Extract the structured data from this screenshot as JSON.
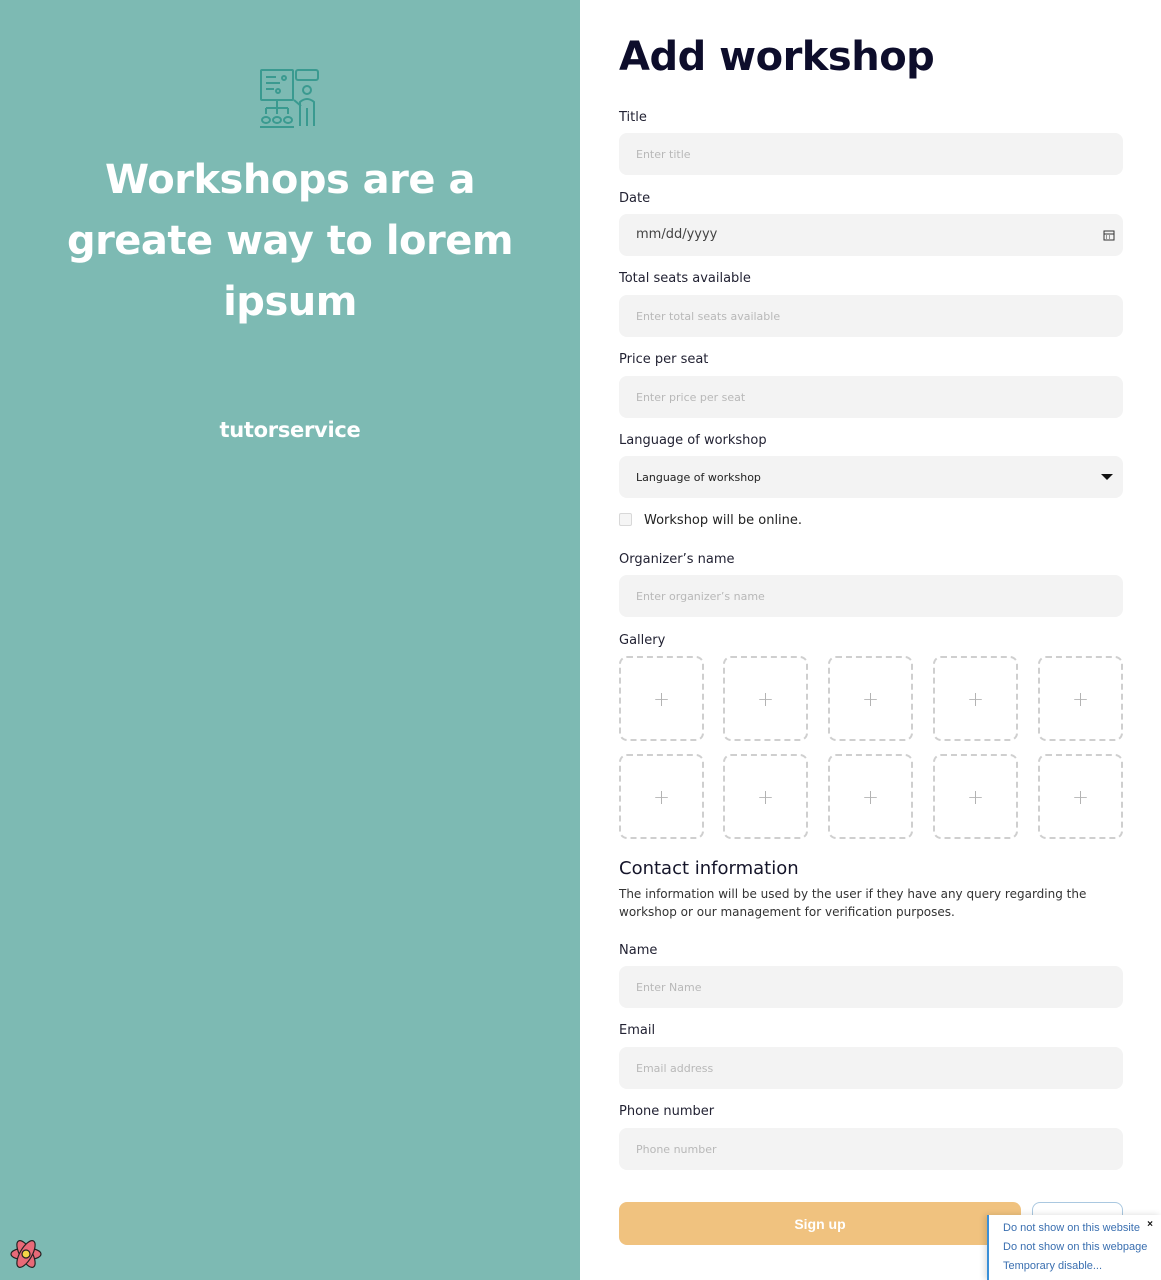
{
  "hero": {
    "title": "Workshops are a greate way to lorem ipsum",
    "brand": "tutorservice"
  },
  "form": {
    "title": "Add workshop",
    "fields": {
      "title": {
        "label": "Title",
        "placeholder": "Enter title"
      },
      "date": {
        "label": "Date",
        "value": "mm/dd/yyyy"
      },
      "seats": {
        "label": "Total seats available",
        "placeholder": "Enter total seats available"
      },
      "price": {
        "label": "Price per seat",
        "placeholder": "Enter price per seat"
      },
      "language": {
        "label": "Language of workshop",
        "placeholder": "Language of workshop"
      },
      "online": {
        "label": "Workshop will be online."
      },
      "organizer": {
        "label": "Organizer’s name",
        "placeholder": "Enter organizer’s name"
      }
    },
    "gallery": {
      "label": "Gallery",
      "add_symbol": "+"
    },
    "contact": {
      "title": "Contact information",
      "description": "The information will be used by the user if they have any query regarding the workshop or our management for verification purposes.",
      "name": {
        "label": "Name",
        "placeholder": "Enter Name"
      },
      "email": {
        "label": "Email",
        "placeholder": "Email address"
      },
      "phone": {
        "label": "Phone number",
        "placeholder": "Phone number"
      }
    },
    "submit_label": "Sign up"
  },
  "extension_popup": {
    "close": "×",
    "items": [
      "Do not show on this website",
      "Do not show on this webpage",
      "Temporary disable..."
    ]
  },
  "colors": {
    "left_panel": "#7dbab3",
    "submit_button": "#f0c27f",
    "field_bg": "#f3f3f3",
    "title": "#0d0d2b"
  }
}
